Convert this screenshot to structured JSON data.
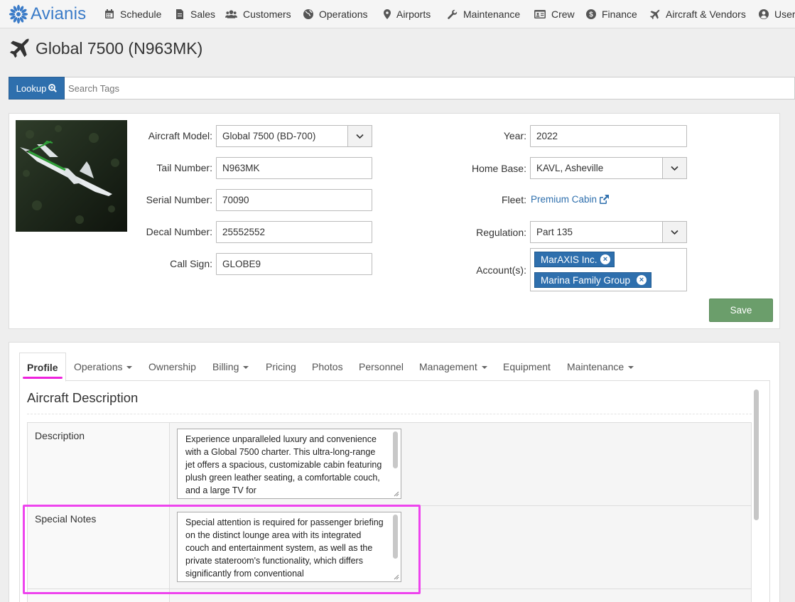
{
  "app": {
    "brand": "Avianis",
    "brand_color": "#3a7bc8"
  },
  "nav": {
    "schedule": "Schedule",
    "sales": "Sales",
    "customers": "Customers",
    "operations": "Operations",
    "airports": "Airports",
    "maintenance": "Maintenance",
    "crew": "Crew",
    "finance": "Finance",
    "aircraft_vendors": "Aircraft & Vendors",
    "user": "User"
  },
  "page": {
    "title": "Global 7500 (N963MK)"
  },
  "search": {
    "lookup_label": "Lookup",
    "placeholder": "Search Tags",
    "value": ""
  },
  "aircraft": {
    "model_label": "Aircraft Model:",
    "model_value": "Global 7500 (BD-700)",
    "tail_label": "Tail Number:",
    "tail_value": "N963MK",
    "serial_label": "Serial Number:",
    "serial_value": "70090",
    "decal_label": "Decal Number:",
    "decal_value": "25552552",
    "callsign_label": "Call Sign:",
    "callsign_value": "GLOBE9",
    "year_label": "Year:",
    "year_value": "2022",
    "homebase_label": "Home Base:",
    "homebase_value": "KAVL, Asheville",
    "fleet_label": "Fleet:",
    "fleet_value": "Premium Cabin",
    "regulation_label": "Regulation:",
    "regulation_value": "Part 135",
    "accounts_label": "Account(s):",
    "accounts": [
      "MarAXIS Inc.",
      "Marina Family Group"
    ],
    "save_label": "Save"
  },
  "tabs": {
    "profile": "Profile",
    "operations": "Operations",
    "ownership": "Ownership",
    "billing": "Billing",
    "pricing": "Pricing",
    "photos": "Photos",
    "personnel": "Personnel",
    "management": "Management",
    "equipment": "Equipment",
    "maintenance": "Maintenance"
  },
  "profile": {
    "section_title": "Aircraft Description",
    "description_label": "Description",
    "description_text": "Experience unparalleled luxury and convenience with a Global 7500 charter. This ultra-long-range jet offers a spacious, customizable cabin featuring plush green leather seating, a comfortable couch, and a large TV for",
    "notes_label": "Special Notes",
    "notes_text": "Special attention is required for passenger briefing on the distinct lounge area with its integrated couch and entertainment system, as well as the private stateroom's functionality, which differs significantly from conventional"
  },
  "colors": {
    "link": "#2e6fad",
    "save": "#6b9e6b",
    "highlight": "#ee44ee"
  }
}
